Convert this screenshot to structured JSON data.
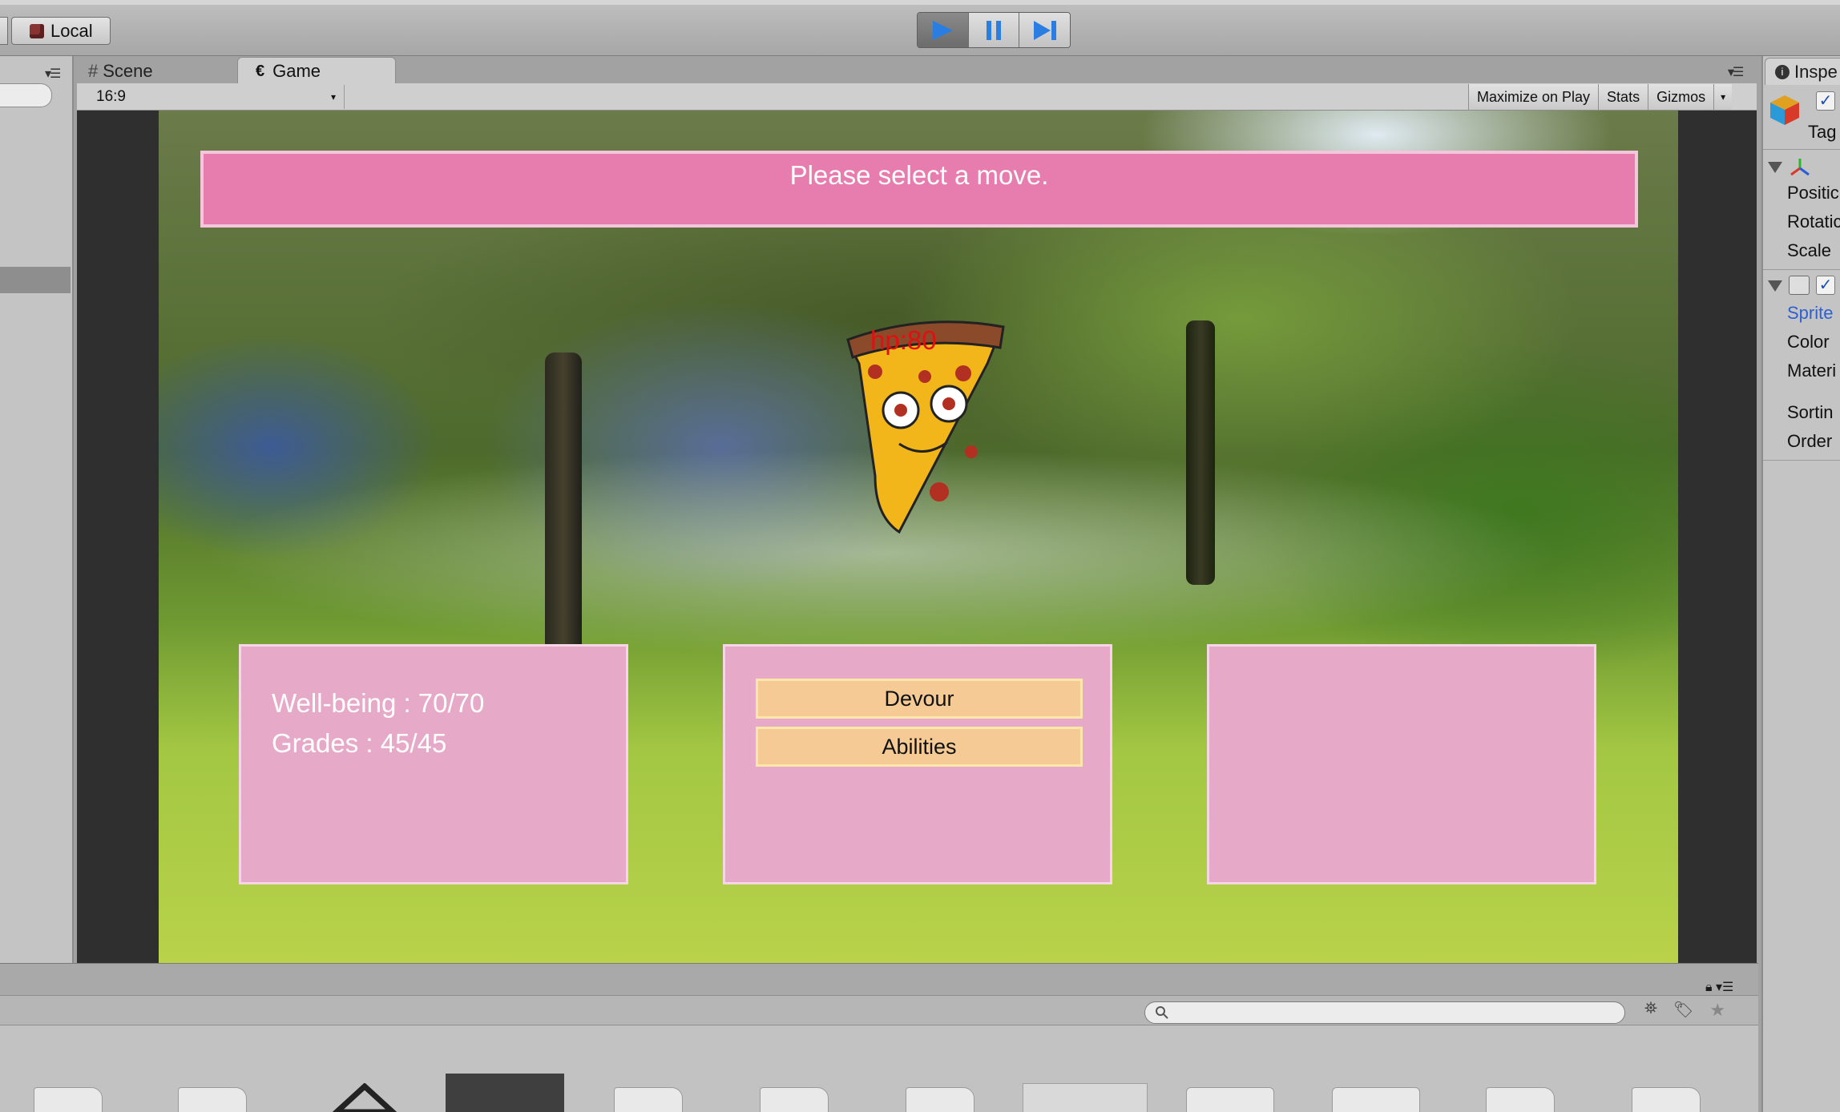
{
  "toolbar": {
    "pivot_label": "Local",
    "play_icon": "play-icon",
    "pause_icon": "pause-icon",
    "step_icon": "step-icon"
  },
  "game_view": {
    "tabs": [
      {
        "label": "Scene",
        "icon": "scene-grid-icon"
      },
      {
        "label": "Game",
        "icon": "game-icon"
      }
    ],
    "aspect_ratio": "16:9",
    "buttons": {
      "maximize_on_play": "Maximize on Play",
      "stats": "Stats",
      "gizmos": "Gizmos"
    }
  },
  "game": {
    "banner_text": "Please select a move.",
    "enemy_hp": "hp:80",
    "player_stats": [
      "Well-being : 70/70",
      "Grades : 45/45"
    ],
    "moves": [
      "Devour",
      "Abilities"
    ]
  },
  "inspector": {
    "tab_label": "Inspe",
    "tag_label": "Tag",
    "transform_fields": [
      "Positic",
      "Rotatic",
      "Scale"
    ],
    "sprite_component_label": "Sprite",
    "sprite_fields": [
      "Color",
      "Materi"
    ],
    "sorting_fields": [
      "Sortin",
      "Order"
    ]
  },
  "colors": {
    "banner": "#e77caf",
    "panel": "#e6aac8",
    "move_button": "#f6ca95",
    "hp_text": "#e01010"
  }
}
